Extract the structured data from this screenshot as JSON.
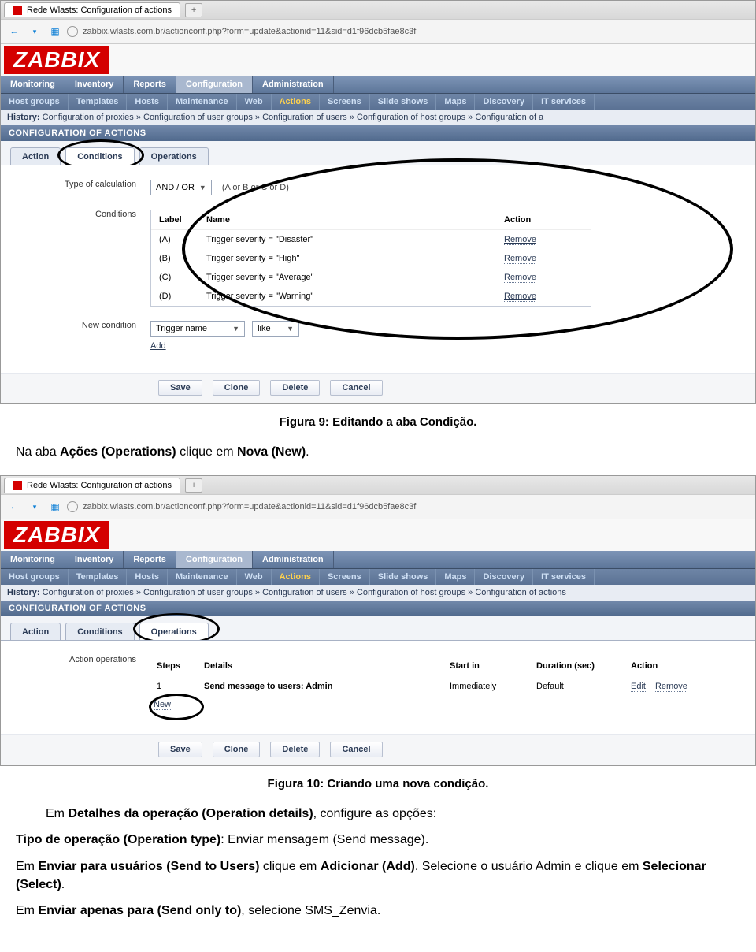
{
  "browser": {
    "tab_title": "Rede Wlasts: Configuration of actions",
    "url": "zabbix.wlasts.com.br/actionconf.php?form=update&actionid=11&sid=d1f96dcb5fae8c3f",
    "newtab_label": "+"
  },
  "logo": "ZABBIX",
  "mainnav": [
    "Monitoring",
    "Inventory",
    "Reports",
    "Configuration",
    "Administration"
  ],
  "mainnav_active": "Configuration",
  "subnav": [
    "Host groups",
    "Templates",
    "Hosts",
    "Maintenance",
    "Web",
    "Actions",
    "Screens",
    "Slide shows",
    "Maps",
    "Discovery",
    "IT services"
  ],
  "subnav_active": "Actions",
  "history_label": "History:",
  "history1": "Configuration of proxies » Configuration of user groups » Configuration of users » Configuration of host groups » Configuration of a",
  "history2": "Configuration of proxies » Configuration of user groups » Configuration of users » Configuration of host groups » Configuration of actions",
  "section_title": "CONFIGURATION OF ACTIONS",
  "tabs": [
    "Action",
    "Conditions",
    "Operations"
  ],
  "fig9": {
    "active_tab": "Conditions",
    "calc_label": "Type of calculation",
    "calc_value": "AND / OR",
    "calc_formula": "(A or B or C or D)",
    "cond_label": "Conditions",
    "cond_headers": {
      "label": "Label",
      "name": "Name",
      "action": "Action"
    },
    "rows": [
      {
        "label": "(A)",
        "name": "Trigger severity = \"Disaster\"",
        "action": "Remove"
      },
      {
        "label": "(B)",
        "name": "Trigger severity = \"High\"",
        "action": "Remove"
      },
      {
        "label": "(C)",
        "name": "Trigger severity = \"Average\"",
        "action": "Remove"
      },
      {
        "label": "(D)",
        "name": "Trigger severity = \"Warning\"",
        "action": "Remove"
      }
    ],
    "newcond_label": "New condition",
    "newcond_field1": "Trigger name",
    "newcond_field2": "like",
    "add_label": "Add"
  },
  "fig10": {
    "active_tab": "Operations",
    "ops_label": "Action operations",
    "headers": {
      "steps": "Steps",
      "details": "Details",
      "start": "Start in",
      "duration": "Duration (sec)",
      "action": "Action"
    },
    "row": {
      "steps": "1",
      "details": "Send message to users: Admin",
      "start": "Immediately",
      "duration": "Default",
      "edit": "Edit",
      "remove": "Remove"
    },
    "new_label": "New"
  },
  "buttons": {
    "save": "Save",
    "clone": "Clone",
    "delete": "Delete",
    "cancel": "Cancel"
  },
  "captions": {
    "fig9": "Figura 9: Editando a aba Condição.",
    "fig10": "Figura 10: Criando uma nova condição."
  },
  "texts": {
    "p1_a": "Na aba ",
    "p1_b": "Ações (Operations)",
    "p1_c": " clique em ",
    "p1_d": "Nova (New)",
    "p1_e": ".",
    "p2_a": "Em ",
    "p2_b": "Detalhes da operação (Operation details)",
    "p2_c": ", configure as opções:",
    "p3_a": "Tipo de operação (Operation type)",
    "p3_b": ": Enviar mensagem (Send message).",
    "p4_a": "Em ",
    "p4_b": "Enviar para usuários (Send to Users)",
    "p4_c": " clique em ",
    "p4_d": "Adicionar (Add)",
    "p4_e": ". Selecione o usuário Admin e clique em ",
    "p4_f": "Selecionar (Select)",
    "p4_g": ".",
    "p5_a": "Em ",
    "p5_b": "Enviar apenas para (Send only to)",
    "p5_c": ", selecione SMS_Zenvia."
  }
}
